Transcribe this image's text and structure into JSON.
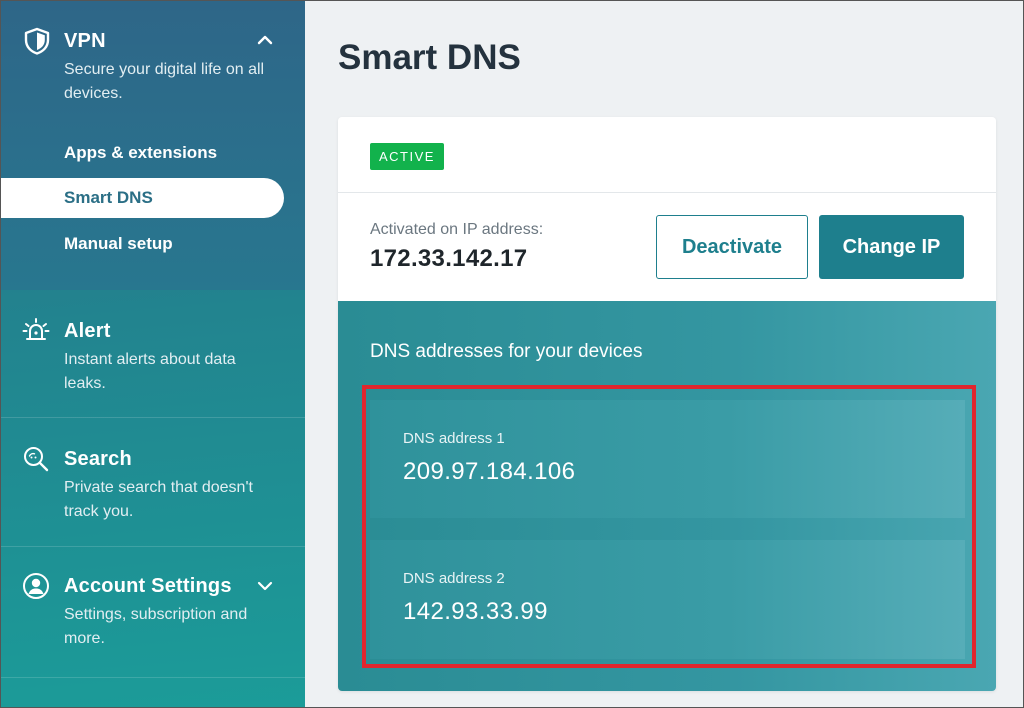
{
  "sidebar": {
    "vpn": {
      "title": "VPN",
      "description": "Secure your digital life on all devices.",
      "icon": "shield-icon",
      "expanded": true,
      "items": [
        {
          "label": "Apps & extensions",
          "active": false
        },
        {
          "label": "Smart DNS",
          "active": true
        },
        {
          "label": "Manual setup",
          "active": false
        }
      ]
    },
    "alert": {
      "title": "Alert",
      "description": "Instant alerts about data leaks.",
      "icon": "alarm-light-icon"
    },
    "search": {
      "title": "Search",
      "description": "Private search that doesn't track you.",
      "icon": "search-icon"
    },
    "account": {
      "title": "Account Settings",
      "description": "Settings, subscription and more.",
      "icon": "user-icon",
      "expanded": false
    }
  },
  "main": {
    "title": "Smart DNS",
    "status_badge": "ACTIVE",
    "activated_label": "Activated on IP address:",
    "ip_address": "172.33.142.17",
    "deactivate_label": "Deactivate",
    "change_ip_label": "Change IP",
    "dns_heading": "DNS addresses for your devices",
    "dns": [
      {
        "label": "DNS address 1",
        "value": "209.97.184.106"
      },
      {
        "label": "DNS address 2",
        "value": "142.93.33.99"
      }
    ]
  },
  "colors": {
    "accent": "#1e7f8d",
    "active_badge": "#12b24c",
    "highlight": "#e0262e",
    "sidebar_top": "#2e6688",
    "sidebar_bottom": "#1b9c99"
  }
}
